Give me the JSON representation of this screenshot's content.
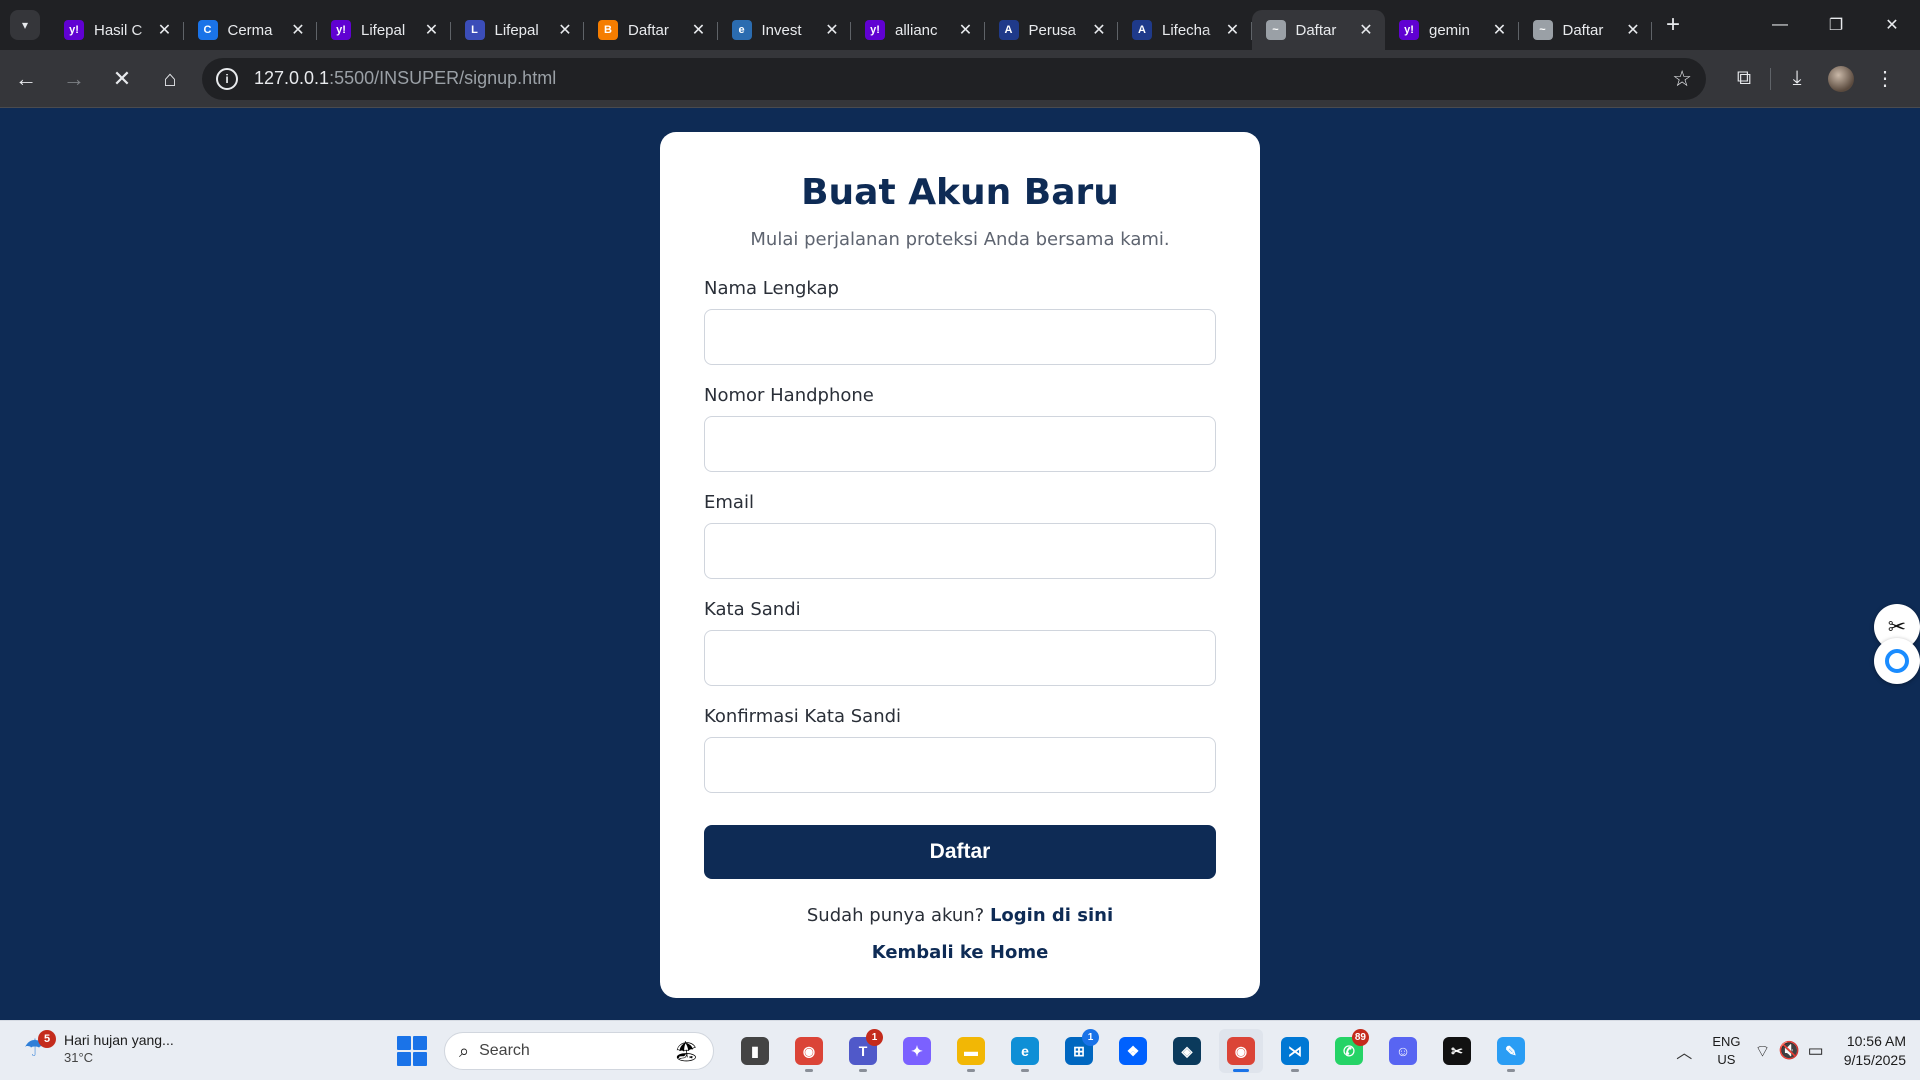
{
  "browser": {
    "tabs": [
      {
        "title": "Hasil C",
        "favicon": "yahoo-icon",
        "color": "#6001d2",
        "glyph": "y!"
      },
      {
        "title": "Cerma",
        "favicon": "c-icon",
        "color": "#1a73e8",
        "glyph": "C"
      },
      {
        "title": "Lifepal",
        "favicon": "yahoo-icon",
        "color": "#6001d2",
        "glyph": "y!"
      },
      {
        "title": "Lifepal",
        "favicon": "lifepal-icon",
        "color": "#3b4db8",
        "glyph": "L"
      },
      {
        "title": "Daftar",
        "favicon": "blogger-icon",
        "color": "#f57d00",
        "glyph": "B"
      },
      {
        "title": "Invest",
        "favicon": "page-icon",
        "color": "#2b6cb0",
        "glyph": "e"
      },
      {
        "title": "allianc",
        "favicon": "yahoo-icon",
        "color": "#6001d2",
        "glyph": "y!"
      },
      {
        "title": "Perusa",
        "favicon": "allianz-icon",
        "color": "#1f3a8a",
        "glyph": "A"
      },
      {
        "title": "Lifecha",
        "favicon": "allianz-icon",
        "color": "#1f3a8a",
        "glyph": "A"
      },
      {
        "title": "Daftar",
        "favicon": "liveserver-icon",
        "color": "#9aa0a6",
        "glyph": "~"
      },
      {
        "title": "gemin",
        "favicon": "yahoo-icon",
        "color": "#6001d2",
        "glyph": "y!"
      },
      {
        "title": "Daftar",
        "favicon": "liveserver-icon",
        "color": "#9aa0a6",
        "glyph": "~"
      }
    ],
    "active_tab_index": 9,
    "url_host": "127.0.0.1",
    "url_rest": ":5500/INSUPER/signup.html"
  },
  "signup": {
    "title": "Buat Akun Baru",
    "subtitle": "Mulai perjalanan proteksi Anda bersama kami.",
    "fields": {
      "name": {
        "label": "Nama Lengkap",
        "value": "",
        "placeholder": ""
      },
      "phone": {
        "label": "Nomor Handphone",
        "value": "",
        "placeholder": ""
      },
      "email": {
        "label": "Email",
        "value": "",
        "placeholder": ""
      },
      "password": {
        "label": "Kata Sandi",
        "value": "",
        "placeholder": ""
      },
      "confirm": {
        "label": "Konfirmasi Kata Sandi",
        "value": "",
        "placeholder": ""
      }
    },
    "submit_label": "Daftar",
    "login_prompt": "Sudah punya akun?",
    "login_link": "Login di sini",
    "home_link": "Kembali ke Home"
  },
  "colors": {
    "page_bg": "#0e2b55",
    "primary": "#0e2b55",
    "card_bg": "#ffffff"
  },
  "taskbar": {
    "weather_title": "Hari hujan yang...",
    "weather_temp": "31°C",
    "weather_badge": "5",
    "search_label": "Search",
    "apps": [
      {
        "name": "file-explorer-window-icon",
        "glyph": "▮",
        "color": "#444",
        "badge": ""
      },
      {
        "name": "chrome-icon",
        "glyph": "◉",
        "color": "#db4437",
        "badge": ""
      },
      {
        "name": "teams-icon",
        "glyph": "T",
        "color": "#5059c9",
        "badge": "1"
      },
      {
        "name": "copilot-icon",
        "glyph": "✦",
        "color": "#7b61ff",
        "badge": ""
      },
      {
        "name": "folder-icon",
        "glyph": "▬",
        "color": "#f2b705",
        "badge": ""
      },
      {
        "name": "edge-icon",
        "glyph": "e",
        "color": "#0f8fd6",
        "badge": ""
      },
      {
        "name": "store-icon",
        "glyph": "⊞",
        "color": "#0067c0",
        "badge": "1"
      },
      {
        "name": "dropbox-icon",
        "glyph": "❖",
        "color": "#0061fe",
        "badge": ""
      },
      {
        "name": "app-dark-icon",
        "glyph": "◈",
        "color": "#0b3a5c",
        "badge": ""
      },
      {
        "name": "chrome-profile-icon",
        "glyph": "◉",
        "color": "#db4437",
        "badge": ""
      },
      {
        "name": "vscode-icon",
        "glyph": "⋊",
        "color": "#0078d4",
        "badge": ""
      },
      {
        "name": "whatsapp-icon",
        "glyph": "✆",
        "color": "#25d366",
        "badge": "89"
      },
      {
        "name": "discord-icon",
        "glyph": "☺",
        "color": "#5865f2",
        "badge": ""
      },
      {
        "name": "capcut-icon",
        "glyph": "✂",
        "color": "#111",
        "badge": ""
      },
      {
        "name": "paint-icon",
        "glyph": "✎",
        "color": "#2a9df4",
        "badge": ""
      }
    ],
    "lang_top": "ENG",
    "lang_bottom": "US",
    "time": "10:56 AM",
    "date": "9/15/2025"
  }
}
